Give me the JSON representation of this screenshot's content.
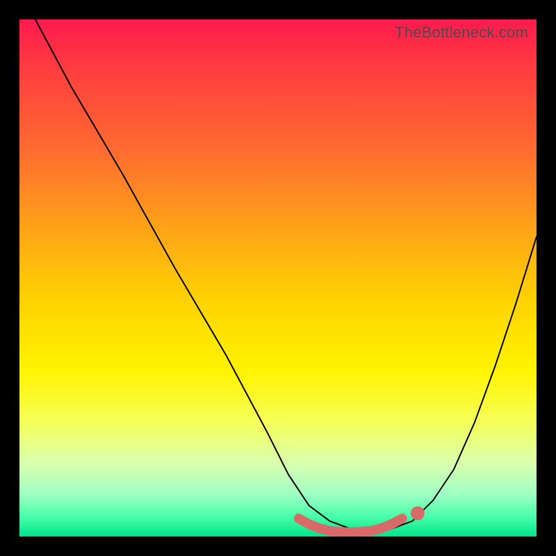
{
  "watermark": "TheBottleneck.com",
  "chart_data": {
    "type": "line",
    "title": "",
    "xlabel": "",
    "ylabel": "",
    "x_range": [
      0,
      100
    ],
    "y_range": [
      0,
      100
    ],
    "series": [
      {
        "name": "curve",
        "x": [
          2,
          10,
          20,
          30,
          40,
          48,
          52,
          56,
          60,
          64,
          68,
          72,
          76,
          80,
          84,
          88,
          92,
          96,
          100
        ],
        "values": [
          102,
          87,
          70,
          52,
          35,
          20,
          12,
          6,
          3,
          1.5,
          1,
          1.5,
          3,
          7,
          13,
          22,
          33,
          45,
          58
        ]
      },
      {
        "name": "thick-flat",
        "x": [
          54,
          56,
          58,
          60,
          62,
          64,
          66,
          68,
          70,
          72,
          74
        ],
        "values": [
          3.5,
          2.4,
          1.6,
          1.1,
          0.9,
          0.8,
          0.9,
          1.1,
          1.6,
          2.4,
          3.5
        ]
      },
      {
        "name": "marker-flat-right",
        "x": [
          77
        ],
        "values": [
          4.5
        ]
      }
    ],
    "styles": {
      "curve_stroke": "#000000",
      "curve_width": 2,
      "flat_stroke": "#d86a6a",
      "flat_width": 14,
      "marker_fill": "#d86a6a",
      "marker_radius": 10
    }
  }
}
